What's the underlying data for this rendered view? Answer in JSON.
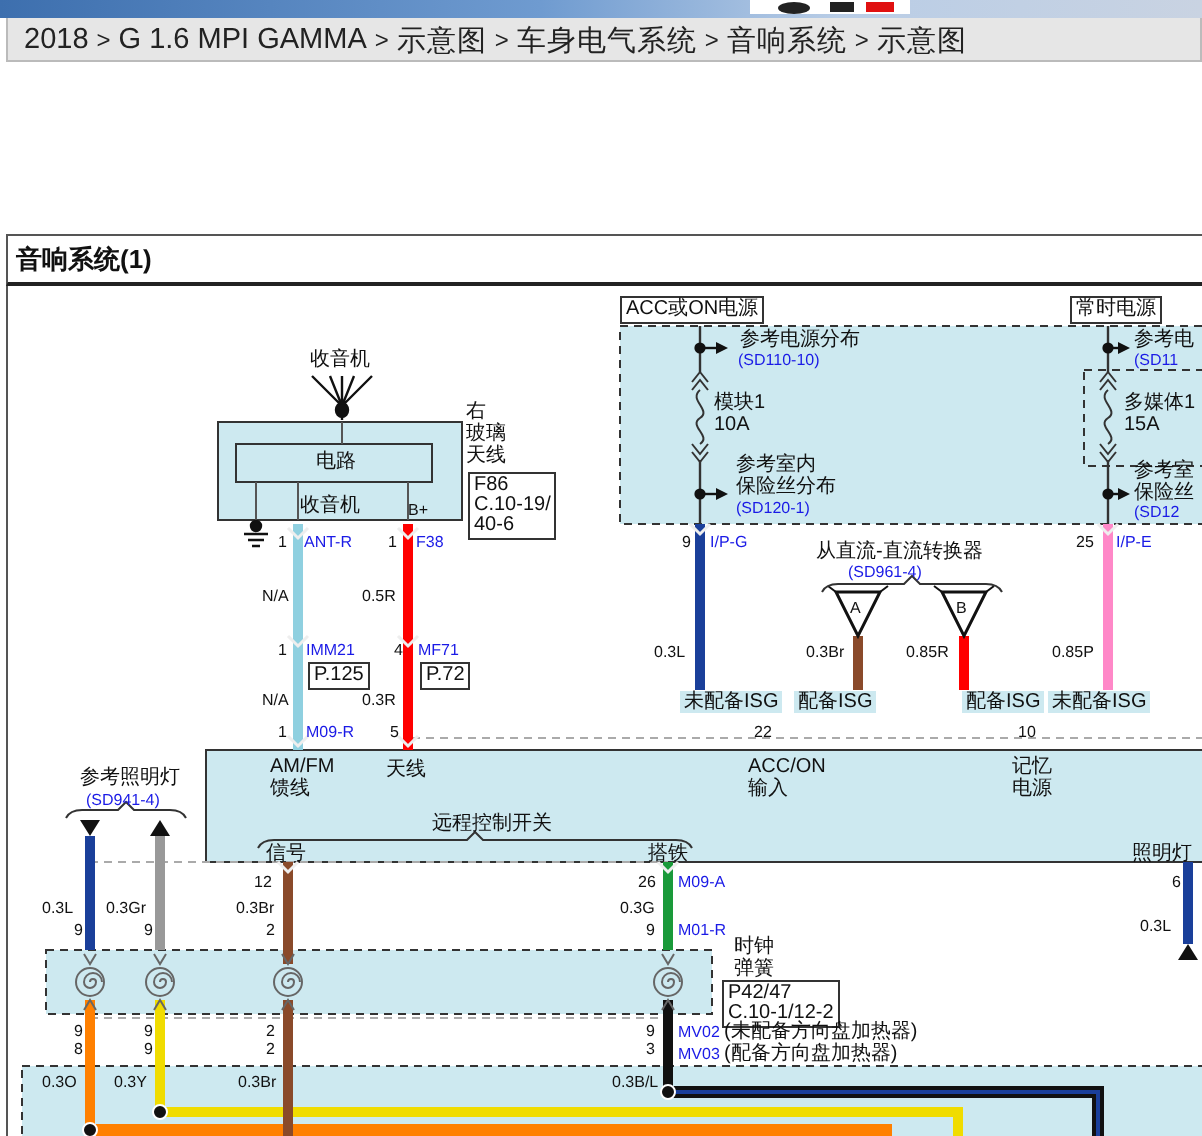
{
  "breadcrumb": {
    "separator": ">",
    "items": [
      "2018",
      "G 1.6 MPI GAMMA",
      "示意图",
      "车身电气系统",
      "音响系统",
      "示意图"
    ]
  },
  "title": "音响系统(1)",
  "diagram": {
    "labels": [
      {
        "text": "收音机",
        "kind": "label"
      },
      {
        "text": "电路",
        "kind": "label"
      },
      {
        "text": "收音机",
        "kind": "label"
      },
      {
        "text": "B+",
        "kind": "code"
      },
      {
        "lines": [
          "右",
          "玻璃",
          "天线"
        ],
        "kind": "label"
      },
      {
        "lines": [
          "F86",
          "C.10-19/",
          "40-6"
        ],
        "kind": "boxed"
      },
      {
        "text": "1",
        "kind": "code"
      },
      {
        "text": "ANT-R",
        "kind": "ref"
      },
      {
        "text": "1",
        "kind": "code"
      },
      {
        "text": "F38",
        "kind": "ref"
      },
      {
        "text": "N/A",
        "kind": "code"
      },
      {
        "text": "0.5R",
        "kind": "code"
      },
      {
        "text": "1",
        "kind": "code"
      },
      {
        "text": "IMM21",
        "kind": "ref"
      },
      {
        "text": "4",
        "kind": "code"
      },
      {
        "text": "MF71",
        "kind": "ref"
      },
      {
        "text": "P.125",
        "kind": "boxed"
      },
      {
        "text": "P.72",
        "kind": "boxed"
      },
      {
        "text": "N/A",
        "kind": "code"
      },
      {
        "text": "0.3R",
        "kind": "code"
      },
      {
        "text": "1",
        "kind": "code"
      },
      {
        "text": "M09-R",
        "kind": "ref"
      },
      {
        "text": "5",
        "kind": "code"
      },
      {
        "text": "ACC或ON电源",
        "kind": "boxed"
      },
      {
        "text": "常时电源",
        "kind": "boxed"
      },
      {
        "text": "参考电源分布",
        "kind": "label"
      },
      {
        "text": "(SD110-10)",
        "kind": "ref"
      },
      {
        "lines": [
          "模块1",
          "10A"
        ],
        "kind": "label"
      },
      {
        "lines": [
          "参考室内",
          "保险丝分布"
        ],
        "kind": "label"
      },
      {
        "text": "(SD120-1)",
        "kind": "ref"
      },
      {
        "text": "参考电",
        "kind": "label"
      },
      {
        "text": "(SD11",
        "kind": "ref"
      },
      {
        "lines": [
          "多媒体1",
          "15A"
        ],
        "kind": "label"
      },
      {
        "lines": [
          "参考室",
          "保险丝"
        ],
        "kind": "label"
      },
      {
        "text": "(SD12",
        "kind": "ref"
      },
      {
        "text": "9",
        "kind": "code"
      },
      {
        "text": "I/P-G",
        "kind": "ref"
      },
      {
        "text": "从直流-直流转换器",
        "kind": "label"
      },
      {
        "text": "(SD961-4)",
        "kind": "ref"
      },
      {
        "text": "25",
        "kind": "code"
      },
      {
        "text": "I/P-E",
        "kind": "ref"
      },
      {
        "text": "A",
        "kind": "code"
      },
      {
        "text": "B",
        "kind": "code"
      },
      {
        "text": "0.3L",
        "kind": "code"
      },
      {
        "text": "0.3Br",
        "kind": "code"
      },
      {
        "text": "0.85R",
        "kind": "code"
      },
      {
        "text": "0.85P",
        "kind": "code"
      },
      {
        "text": "未配备ISG",
        "kind": "tag"
      },
      {
        "text": "配备ISG",
        "kind": "tag"
      },
      {
        "text": "配备ISG",
        "kind": "tag"
      },
      {
        "text": "未配备ISG",
        "kind": "tag"
      },
      {
        "text": "22",
        "kind": "code"
      },
      {
        "text": "10",
        "kind": "code"
      },
      {
        "lines": [
          "AM/FM",
          "馈线"
        ],
        "kind": "label"
      },
      {
        "text": "天线",
        "kind": "label"
      },
      {
        "lines": [
          "ACC/ON",
          "输入"
        ],
        "kind": "label"
      },
      {
        "lines": [
          "记忆",
          "电源"
        ],
        "kind": "label"
      },
      {
        "text": "远程控制开关",
        "kind": "label"
      },
      {
        "text": "信号",
        "kind": "label"
      },
      {
        "text": "搭铁",
        "kind": "label"
      },
      {
        "text": "照明灯",
        "kind": "label"
      },
      {
        "text": "参考照明灯",
        "kind": "label"
      },
      {
        "text": "(SD941-4)",
        "kind": "ref"
      },
      {
        "text": "0.3L",
        "kind": "code"
      },
      {
        "text": "0.3Gr",
        "kind": "code"
      },
      {
        "text": "9",
        "kind": "code"
      },
      {
        "text": "9",
        "kind": "code"
      },
      {
        "text": "12",
        "kind": "code"
      },
      {
        "text": "0.3Br",
        "kind": "code"
      },
      {
        "text": "2",
        "kind": "code"
      },
      {
        "text": "26",
        "kind": "code"
      },
      {
        "text": "M09-A",
        "kind": "ref"
      },
      {
        "text": "0.3G",
        "kind": "code"
      },
      {
        "text": "9",
        "kind": "code"
      },
      {
        "text": "M01-R",
        "kind": "ref"
      },
      {
        "text": "6",
        "kind": "code"
      },
      {
        "text": "0.3L",
        "kind": "code"
      },
      {
        "lines": [
          "时钟",
          "弹簧"
        ],
        "kind": "label"
      },
      {
        "lines": [
          "P42/47",
          "C.10-1/12-2"
        ],
        "kind": "boxed"
      },
      {
        "lines": [
          "9",
          "8"
        ],
        "kind": "code"
      },
      {
        "lines": [
          "9",
          "9"
        ],
        "kind": "code"
      },
      {
        "lines": [
          "2",
          "2"
        ],
        "kind": "code"
      },
      {
        "lines": [
          "9",
          "3"
        ],
        "kind": "code"
      },
      {
        "text": "MV02",
        "kind": "ref"
      },
      {
        "text": "(未配备方向盘加热器)",
        "kind": "label"
      },
      {
        "text": "MV03",
        "kind": "ref"
      },
      {
        "text": "(配备方向盘加热器)",
        "kind": "label"
      },
      {
        "text": "0.3O",
        "kind": "code"
      },
      {
        "text": "0.3Y",
        "kind": "code"
      },
      {
        "text": "0.3Br",
        "kind": "code"
      },
      {
        "text": "0.3B/L",
        "kind": "code"
      }
    ]
  }
}
